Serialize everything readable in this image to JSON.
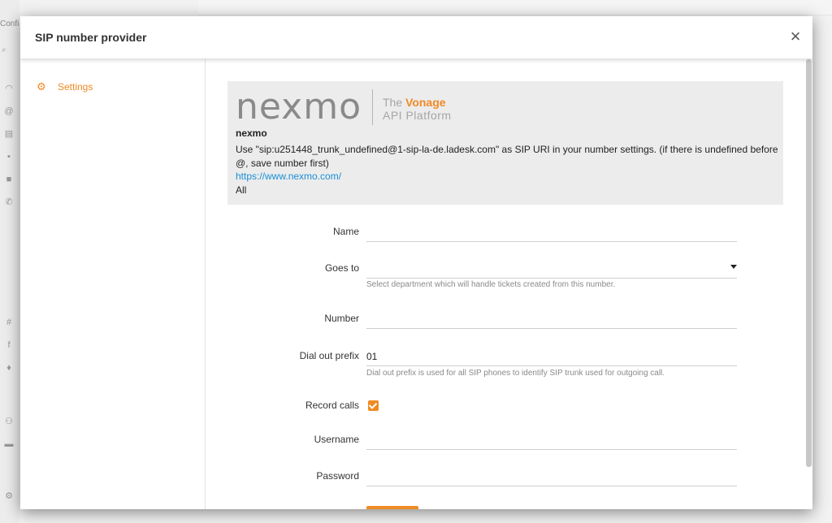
{
  "background": {
    "config_label": "Confi",
    "search_icon": "search-icon",
    "rail_icons": [
      "rss-icon",
      "at-icon",
      "note-icon",
      "chat-icon",
      "video-icon",
      "phone-icon",
      "slack-icon",
      "facebook-icon",
      "twitter-icon",
      "people-icon",
      "folder-icon",
      "gear-icon"
    ]
  },
  "modal": {
    "title": "SIP number provider",
    "close_label": "×"
  },
  "sidebar": {
    "items": [
      {
        "label": "Settings",
        "icon": "gear-icon"
      }
    ]
  },
  "provider": {
    "logo_text": "nexmo",
    "logo_the": "The",
    "logo_brand": "Vonage",
    "logo_tagline": "API Platform",
    "name": "nexmo",
    "description": "Use \"sip:u251448_trunk_undefined@1-sip-la-de.ladesk.com\" as SIP URI in your number settings. (if there is undefined before @, save number first)",
    "link": "https://www.nexmo.com/",
    "scope": "All"
  },
  "form": {
    "name_label": "Name",
    "name_value": "",
    "goes_to_label": "Goes to",
    "goes_to_value": "",
    "goes_to_hint": "Select department which will handle tickets created from this number.",
    "number_label": "Number",
    "number_value": "",
    "dial_out_label": "Dial out prefix",
    "dial_out_value": "01",
    "dial_out_hint": "Dial out prefix is used for all SIP phones to identify SIP trunk used for outgoing call.",
    "record_calls_label": "Record calls",
    "record_calls_checked": true,
    "username_label": "Username",
    "username_value": "",
    "password_label": "Password",
    "password_value": ""
  },
  "colors": {
    "accent": "#f08a24",
    "link": "#1a8fd6"
  }
}
